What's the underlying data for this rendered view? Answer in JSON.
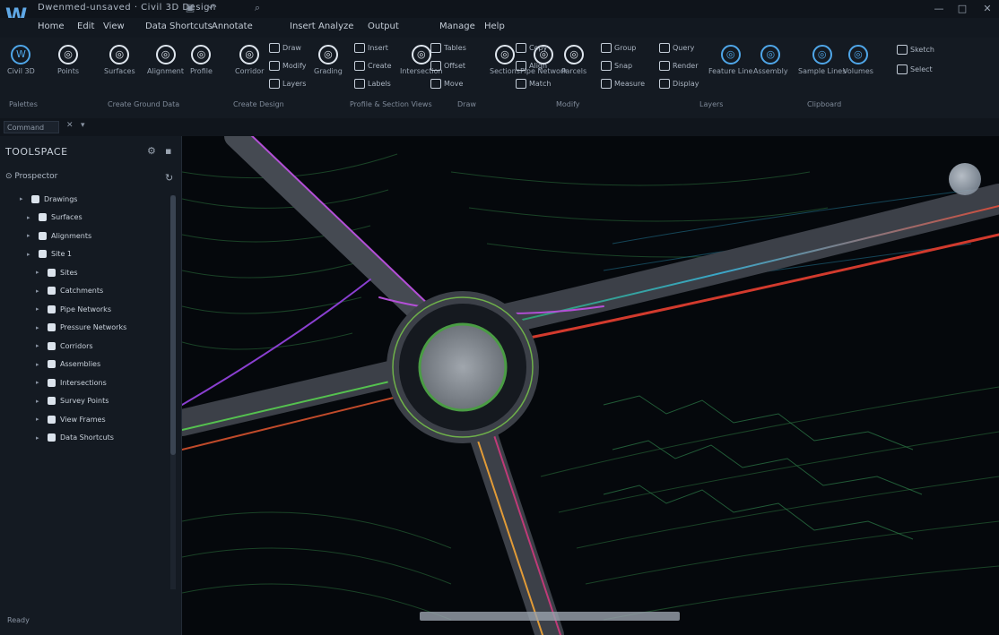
{
  "window": {
    "title": "Dwenmed-unsaved · Civil 3D Design",
    "logo": "W"
  },
  "menu": [
    "Home",
    "Edit",
    "View",
    "Data Shortcuts",
    "Annotate",
    "Insert",
    "Analyze",
    "Output",
    "Manage",
    "Help"
  ],
  "ribbon": {
    "big_buttons": [
      {
        "label": "Civil 3D",
        "icon": "civil3d-icon"
      },
      {
        "label": "Points",
        "icon": "points-icon"
      },
      {
        "label": "Surfaces",
        "icon": "surface-icon"
      },
      {
        "label": "Alignment",
        "icon": "alignment-icon"
      },
      {
        "label": "Profile",
        "icon": "profile-icon"
      },
      {
        "label": "Corridor",
        "icon": "corridor-icon"
      },
      {
        "label": "Grading",
        "icon": "grading-icon"
      },
      {
        "label": "Intersection",
        "icon": "intersection-icon"
      },
      {
        "label": "Sections",
        "icon": "sections-icon"
      },
      {
        "label": "Pipe Network",
        "icon": "pipe-icon"
      },
      {
        "label": "Parcels",
        "icon": "parcel-icon"
      },
      {
        "label": "Feature Line",
        "icon": "featureline-icon"
      },
      {
        "label": "Assembly",
        "icon": "assembly-icon"
      },
      {
        "label": "Sample Lines",
        "icon": "samplelines-icon"
      },
      {
        "label": "Volumes",
        "icon": "volumes-icon"
      }
    ],
    "small_buttons": [
      "Draw",
      "Modify",
      "Layers",
      "Insert",
      "Create",
      "Labels",
      "Tables",
      "Offset",
      "Move",
      "Copy",
      "Align",
      "Match",
      "Group",
      "Snap",
      "Measure",
      "Query",
      "Render",
      "Display",
      "Sketch",
      "Select"
    ],
    "groups": [
      "Palettes",
      "Create Ground Data",
      "Create Design",
      "Profile & Section Views",
      "Draw",
      "Modify",
      "Layers",
      "Clipboard"
    ]
  },
  "command": {
    "placeholder": "Command"
  },
  "sidebar": {
    "title": "TOOLSPACE",
    "filter_label": "Prospector",
    "tree": [
      "Drawings",
      "Surfaces",
      "Alignments",
      "Site 1",
      "Sites",
      "Catchments",
      "Pipe Networks",
      "Pressure Networks",
      "Corridors",
      "Assemblies",
      "Intersections",
      "Survey Points",
      "View Frames",
      "Data Shortcuts"
    ],
    "footer": "Ready"
  },
  "viewport": {
    "description_visible": false
  }
}
